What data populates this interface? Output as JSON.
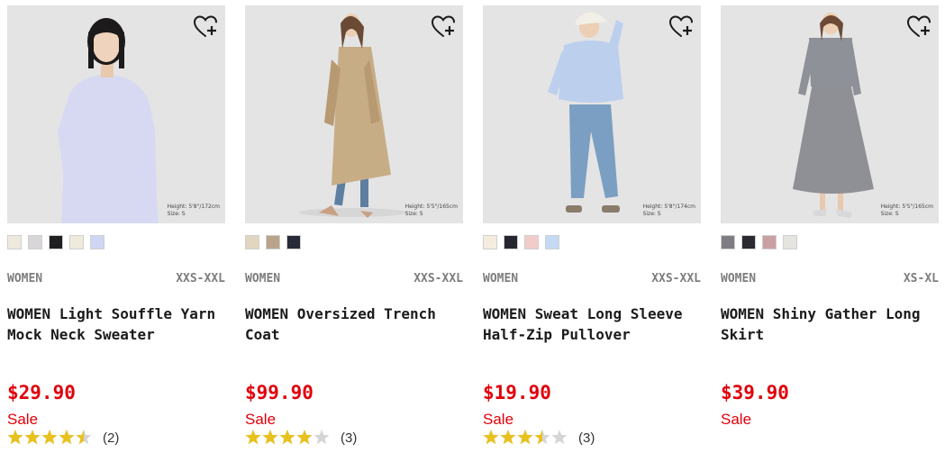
{
  "products": [
    {
      "gender": "WOMEN",
      "sizes": "XXS-XXL",
      "name_line1": "WOMEN Light Souffle Yarn",
      "name_line2": "Mock Neck Sweater",
      "price": "$29.90",
      "flag": "Sale",
      "rating": 4.5,
      "review_count": "(2)",
      "model_note_line1": "Height: 5'8\"/172cm",
      "model_note_line2": "Size: S",
      "wishlist_icon": "heart-plus-icon",
      "colors": [
        "#eee9dd",
        "#d9d6da",
        "#1f1f22",
        "#efebdc",
        "#cfd6f4"
      ],
      "garment_color": "#d7d9f3",
      "bottom_color": "#7f8b93"
    },
    {
      "gender": "WOMEN",
      "sizes": "XXS-XXL",
      "name_line1": "WOMEN Oversized Trench",
      "name_line2": "Coat",
      "price": "$99.90",
      "flag": "Sale",
      "rating": 4,
      "review_count": "(3)",
      "model_note_line1": "Height: 5'5\"/165cm",
      "model_note_line2": "Size: S",
      "wishlist_icon": "heart-plus-icon",
      "colors": [
        "#e3d6c0",
        "#b9a48b",
        "#292a38"
      ],
      "garment_color": "#c7ad86",
      "bottom_color": "#5d7ea0"
    },
    {
      "gender": "WOMEN",
      "sizes": "XXS-XXL",
      "name_line1": "WOMEN Sweat Long Sleeve",
      "name_line2": "Half-Zip Pullover",
      "price": "$19.90",
      "flag": "Sale",
      "rating": 3.5,
      "review_count": "(3)",
      "model_note_line1": "Height: 5'8\"/174cm",
      "model_note_line2": "Size: S",
      "wishlist_icon": "heart-plus-icon",
      "colors": [
        "#f4eddf",
        "#26272e",
        "#f1ccc8",
        "#c5d8f4"
      ],
      "garment_color": "#bcd0ee",
      "bottom_color": "#7b9fc2"
    },
    {
      "gender": "WOMEN",
      "sizes": "XS-XL",
      "name_line1": "WOMEN Shiny Gather Long",
      "name_line2": "Skirt",
      "price": "$39.90",
      "flag": "Sale",
      "rating": null,
      "review_count": "",
      "model_note_line1": "Height: 5'5\"/165cm",
      "model_note_line2": "Size: S",
      "wishlist_icon": "heart-plus-icon",
      "colors": [
        "#7f7d83",
        "#2a2a30",
        "#c9a1a2",
        "#e6e4df"
      ],
      "garment_color": "#8b8c90",
      "bottom_color": "#8f9095"
    }
  ],
  "colors": {
    "price_red": "#e0000a",
    "star_gold": "#e8c11c",
    "star_empty": "#d5d5d5"
  }
}
